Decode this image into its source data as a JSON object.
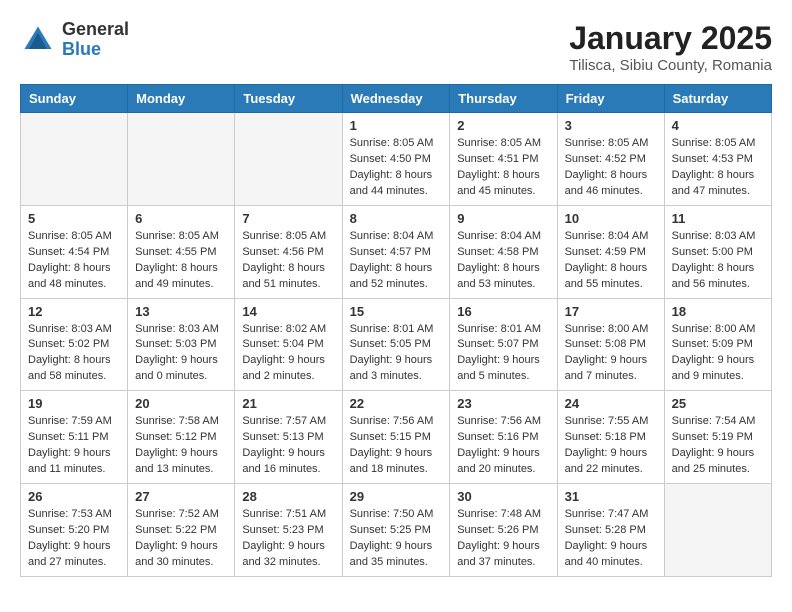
{
  "logo": {
    "line1": "General",
    "line2": "Blue"
  },
  "title": "January 2025",
  "subtitle": "Tilisca, Sibiu County, Romania",
  "headers": [
    "Sunday",
    "Monday",
    "Tuesday",
    "Wednesday",
    "Thursday",
    "Friday",
    "Saturday"
  ],
  "weeks": [
    [
      {
        "day": "",
        "info": ""
      },
      {
        "day": "",
        "info": ""
      },
      {
        "day": "",
        "info": ""
      },
      {
        "day": "1",
        "info": "Sunrise: 8:05 AM\nSunset: 4:50 PM\nDaylight: 8 hours\nand 44 minutes."
      },
      {
        "day": "2",
        "info": "Sunrise: 8:05 AM\nSunset: 4:51 PM\nDaylight: 8 hours\nand 45 minutes."
      },
      {
        "day": "3",
        "info": "Sunrise: 8:05 AM\nSunset: 4:52 PM\nDaylight: 8 hours\nand 46 minutes."
      },
      {
        "day": "4",
        "info": "Sunrise: 8:05 AM\nSunset: 4:53 PM\nDaylight: 8 hours\nand 47 minutes."
      }
    ],
    [
      {
        "day": "5",
        "info": "Sunrise: 8:05 AM\nSunset: 4:54 PM\nDaylight: 8 hours\nand 48 minutes."
      },
      {
        "day": "6",
        "info": "Sunrise: 8:05 AM\nSunset: 4:55 PM\nDaylight: 8 hours\nand 49 minutes."
      },
      {
        "day": "7",
        "info": "Sunrise: 8:05 AM\nSunset: 4:56 PM\nDaylight: 8 hours\nand 51 minutes."
      },
      {
        "day": "8",
        "info": "Sunrise: 8:04 AM\nSunset: 4:57 PM\nDaylight: 8 hours\nand 52 minutes."
      },
      {
        "day": "9",
        "info": "Sunrise: 8:04 AM\nSunset: 4:58 PM\nDaylight: 8 hours\nand 53 minutes."
      },
      {
        "day": "10",
        "info": "Sunrise: 8:04 AM\nSunset: 4:59 PM\nDaylight: 8 hours\nand 55 minutes."
      },
      {
        "day": "11",
        "info": "Sunrise: 8:03 AM\nSunset: 5:00 PM\nDaylight: 8 hours\nand 56 minutes."
      }
    ],
    [
      {
        "day": "12",
        "info": "Sunrise: 8:03 AM\nSunset: 5:02 PM\nDaylight: 8 hours\nand 58 minutes."
      },
      {
        "day": "13",
        "info": "Sunrise: 8:03 AM\nSunset: 5:03 PM\nDaylight: 9 hours\nand 0 minutes."
      },
      {
        "day": "14",
        "info": "Sunrise: 8:02 AM\nSunset: 5:04 PM\nDaylight: 9 hours\nand 2 minutes."
      },
      {
        "day": "15",
        "info": "Sunrise: 8:01 AM\nSunset: 5:05 PM\nDaylight: 9 hours\nand 3 minutes."
      },
      {
        "day": "16",
        "info": "Sunrise: 8:01 AM\nSunset: 5:07 PM\nDaylight: 9 hours\nand 5 minutes."
      },
      {
        "day": "17",
        "info": "Sunrise: 8:00 AM\nSunset: 5:08 PM\nDaylight: 9 hours\nand 7 minutes."
      },
      {
        "day": "18",
        "info": "Sunrise: 8:00 AM\nSunset: 5:09 PM\nDaylight: 9 hours\nand 9 minutes."
      }
    ],
    [
      {
        "day": "19",
        "info": "Sunrise: 7:59 AM\nSunset: 5:11 PM\nDaylight: 9 hours\nand 11 minutes."
      },
      {
        "day": "20",
        "info": "Sunrise: 7:58 AM\nSunset: 5:12 PM\nDaylight: 9 hours\nand 13 minutes."
      },
      {
        "day": "21",
        "info": "Sunrise: 7:57 AM\nSunset: 5:13 PM\nDaylight: 9 hours\nand 16 minutes."
      },
      {
        "day": "22",
        "info": "Sunrise: 7:56 AM\nSunset: 5:15 PM\nDaylight: 9 hours\nand 18 minutes."
      },
      {
        "day": "23",
        "info": "Sunrise: 7:56 AM\nSunset: 5:16 PM\nDaylight: 9 hours\nand 20 minutes."
      },
      {
        "day": "24",
        "info": "Sunrise: 7:55 AM\nSunset: 5:18 PM\nDaylight: 9 hours\nand 22 minutes."
      },
      {
        "day": "25",
        "info": "Sunrise: 7:54 AM\nSunset: 5:19 PM\nDaylight: 9 hours\nand 25 minutes."
      }
    ],
    [
      {
        "day": "26",
        "info": "Sunrise: 7:53 AM\nSunset: 5:20 PM\nDaylight: 9 hours\nand 27 minutes."
      },
      {
        "day": "27",
        "info": "Sunrise: 7:52 AM\nSunset: 5:22 PM\nDaylight: 9 hours\nand 30 minutes."
      },
      {
        "day": "28",
        "info": "Sunrise: 7:51 AM\nSunset: 5:23 PM\nDaylight: 9 hours\nand 32 minutes."
      },
      {
        "day": "29",
        "info": "Sunrise: 7:50 AM\nSunset: 5:25 PM\nDaylight: 9 hours\nand 35 minutes."
      },
      {
        "day": "30",
        "info": "Sunrise: 7:48 AM\nSunset: 5:26 PM\nDaylight: 9 hours\nand 37 minutes."
      },
      {
        "day": "31",
        "info": "Sunrise: 7:47 AM\nSunset: 5:28 PM\nDaylight: 9 hours\nand 40 minutes."
      },
      {
        "day": "",
        "info": ""
      }
    ]
  ]
}
